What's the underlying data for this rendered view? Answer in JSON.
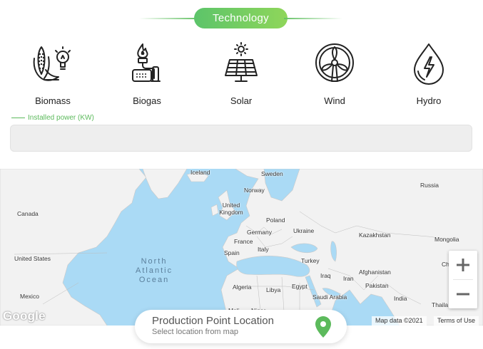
{
  "technology": {
    "title": "Technology",
    "options": [
      {
        "label": "Biomass",
        "icon": "biomass-corn-bulb-icon"
      },
      {
        "label": "Biogas",
        "icon": "biogas-flame-icon"
      },
      {
        "label": "Solar",
        "icon": "solar-panel-icon"
      },
      {
        "label": "Wind",
        "icon": "wind-turbine-icon"
      },
      {
        "label": "Hydro",
        "icon": "water-drop-bolt-icon"
      }
    ]
  },
  "installed_power": {
    "label": "Installed power (KW)",
    "value": ""
  },
  "map": {
    "places": {
      "iceland": "Iceland",
      "sweden": "Sweden",
      "norway": "Norway",
      "russia": "Russia",
      "canada": "Canada",
      "uk": "United Kingdom",
      "poland": "Poland",
      "germany": "Germany",
      "ukraine": "Ukraine",
      "kazakhstan": "Kazakhstan",
      "mongolia": "Mongolia",
      "france": "France",
      "italy": "Italy",
      "spain": "Spain",
      "usa": "United States",
      "turkey": "Turkey",
      "iraq": "Iraq",
      "iran": "Iran",
      "afghanistan": "Afghanistan",
      "pakistan": "Pakistan",
      "algeria": "Algeria",
      "libya": "Libya",
      "egypt": "Egypt",
      "saudi": "Saudi Arabia",
      "india": "India",
      "mexico": "Mexico",
      "thailand": "Thaila",
      "china": "Ch",
      "mali": "Mali",
      "niger": "Niger"
    },
    "ocean_label": "North Atlantic Ocean",
    "ocean_lines": [
      "North",
      "Atlantic",
      "Ocean"
    ],
    "google_logo": "Google",
    "attribution": "Map data ©2021",
    "terms": "Terms of Use",
    "colors": {
      "water": "#aadaf5",
      "land": "#f2f2f2"
    }
  },
  "location_card": {
    "title": "Production Point Location",
    "subtitle": "Select location from map",
    "pin_color": "#5cba5c"
  },
  "colors": {
    "accent": "#5cc46a",
    "accent_end": "#8fd65a"
  }
}
